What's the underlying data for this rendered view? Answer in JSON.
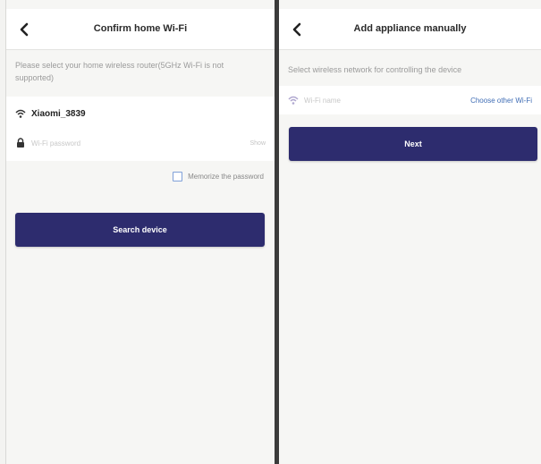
{
  "left_screen": {
    "title": "Confirm home Wi-Fi",
    "back_icon": "chevron-left-icon",
    "hint": "Please select your home wireless router(5GHz Wi-Fi is not supported)",
    "ssid": "Xiaomi_3839",
    "ssid_icon": "wifi-icon",
    "password_icon": "lock-icon",
    "password_placeholder": "Wi-Fi password",
    "password_toggle": "Show",
    "remember_label": "Memorize the password",
    "remember_checked": false,
    "search_button": "Search device"
  },
  "right_screen": {
    "title": "Add appliance manually",
    "back_icon": "chevron-left-icon",
    "hint": "Select wireless network for controlling the device",
    "wifi_icon": "wifi-icon",
    "network_placeholder": "Wi-Fi name",
    "choose_link": "Choose other Wi-Fi",
    "next_button": "Next"
  },
  "colors": {
    "primary_button": "#2d2c6e",
    "link": "#3f6db5",
    "checkbox_border": "#7fa0d8",
    "background": "#f6f6f4"
  }
}
